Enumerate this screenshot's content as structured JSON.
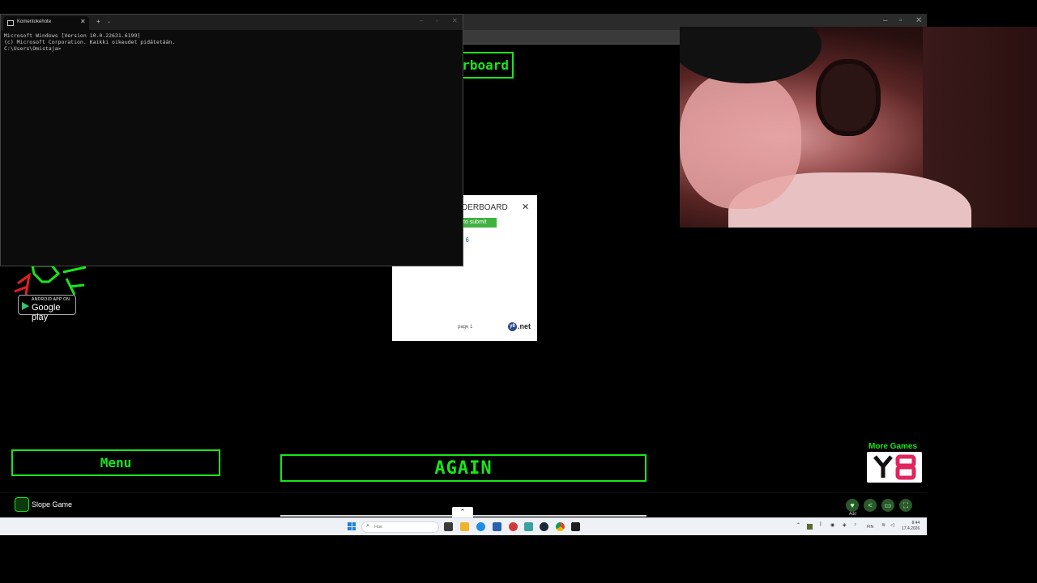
{
  "cmd_window": {
    "tab_title": "Komentokehote",
    "console_lines": [
      "Microsoft Windows [Version 10.0.22631.6199]",
      "(c) Microsoft Corporation. Kaikki oikeudet pidätetään.",
      "",
      "C:\\Users\\Omistaja>"
    ]
  },
  "game": {
    "leaderboard_button": "rboard",
    "menu_button": "Menu",
    "again_button": "AGAIN",
    "google_play": {
      "small": "ANDROID APP ON",
      "big": "Google play"
    },
    "more_games": "More Games",
    "app_name": "Slope Game",
    "add_label": "Add"
  },
  "leaderboard_popup": {
    "title": "DERBOARD",
    "close": "✕",
    "submit": "to submit",
    "score": ": 6",
    "page": "page 1",
    "brand": ".net",
    "brand_badge": "y8"
  },
  "taskbar": {
    "search_placeholder": "Hae",
    "language": "FIN",
    "time": "8:44",
    "date": "17.4.2026"
  },
  "colors": {
    "accent_green": "#19e619",
    "popup_submit": "#3fb23f"
  }
}
